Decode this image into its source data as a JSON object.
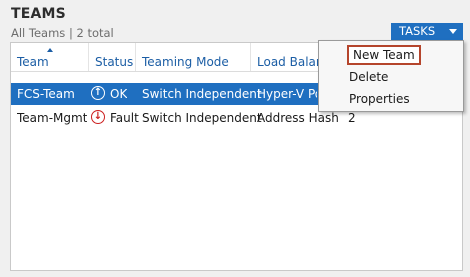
{
  "panel": {
    "title": "TEAMS",
    "subtitle": "All Teams | 2 total"
  },
  "tasks_button": {
    "label": "TASKS",
    "color": "#1f6fc0"
  },
  "table": {
    "columns": [
      "Team",
      "Status",
      "Teaming Mode",
      "Load Balancing"
    ],
    "rows": [
      {
        "team": "FCS-Team",
        "status": "OK",
        "status_icon": "arrow-up-icon",
        "teaming_mode": "Switch Independent",
        "load_balancing": "Hyper-V Port",
        "extra": "",
        "selected": true
      },
      {
        "team": "Team-Mgmt",
        "status": "Fault",
        "status_icon": "arrow-down-icon",
        "teaming_mode": "Switch Independent",
        "load_balancing": "Address Hash",
        "extra": "2",
        "selected": false
      }
    ]
  },
  "tasks_menu": {
    "items": [
      "New Team",
      "Delete",
      "Properties"
    ],
    "highlighted_item": "New Team",
    "highlight_color": "#b5452c"
  },
  "colors": {
    "accent": "#1f6fc0",
    "ok": "#ffffff",
    "fault": "#cc2020"
  }
}
